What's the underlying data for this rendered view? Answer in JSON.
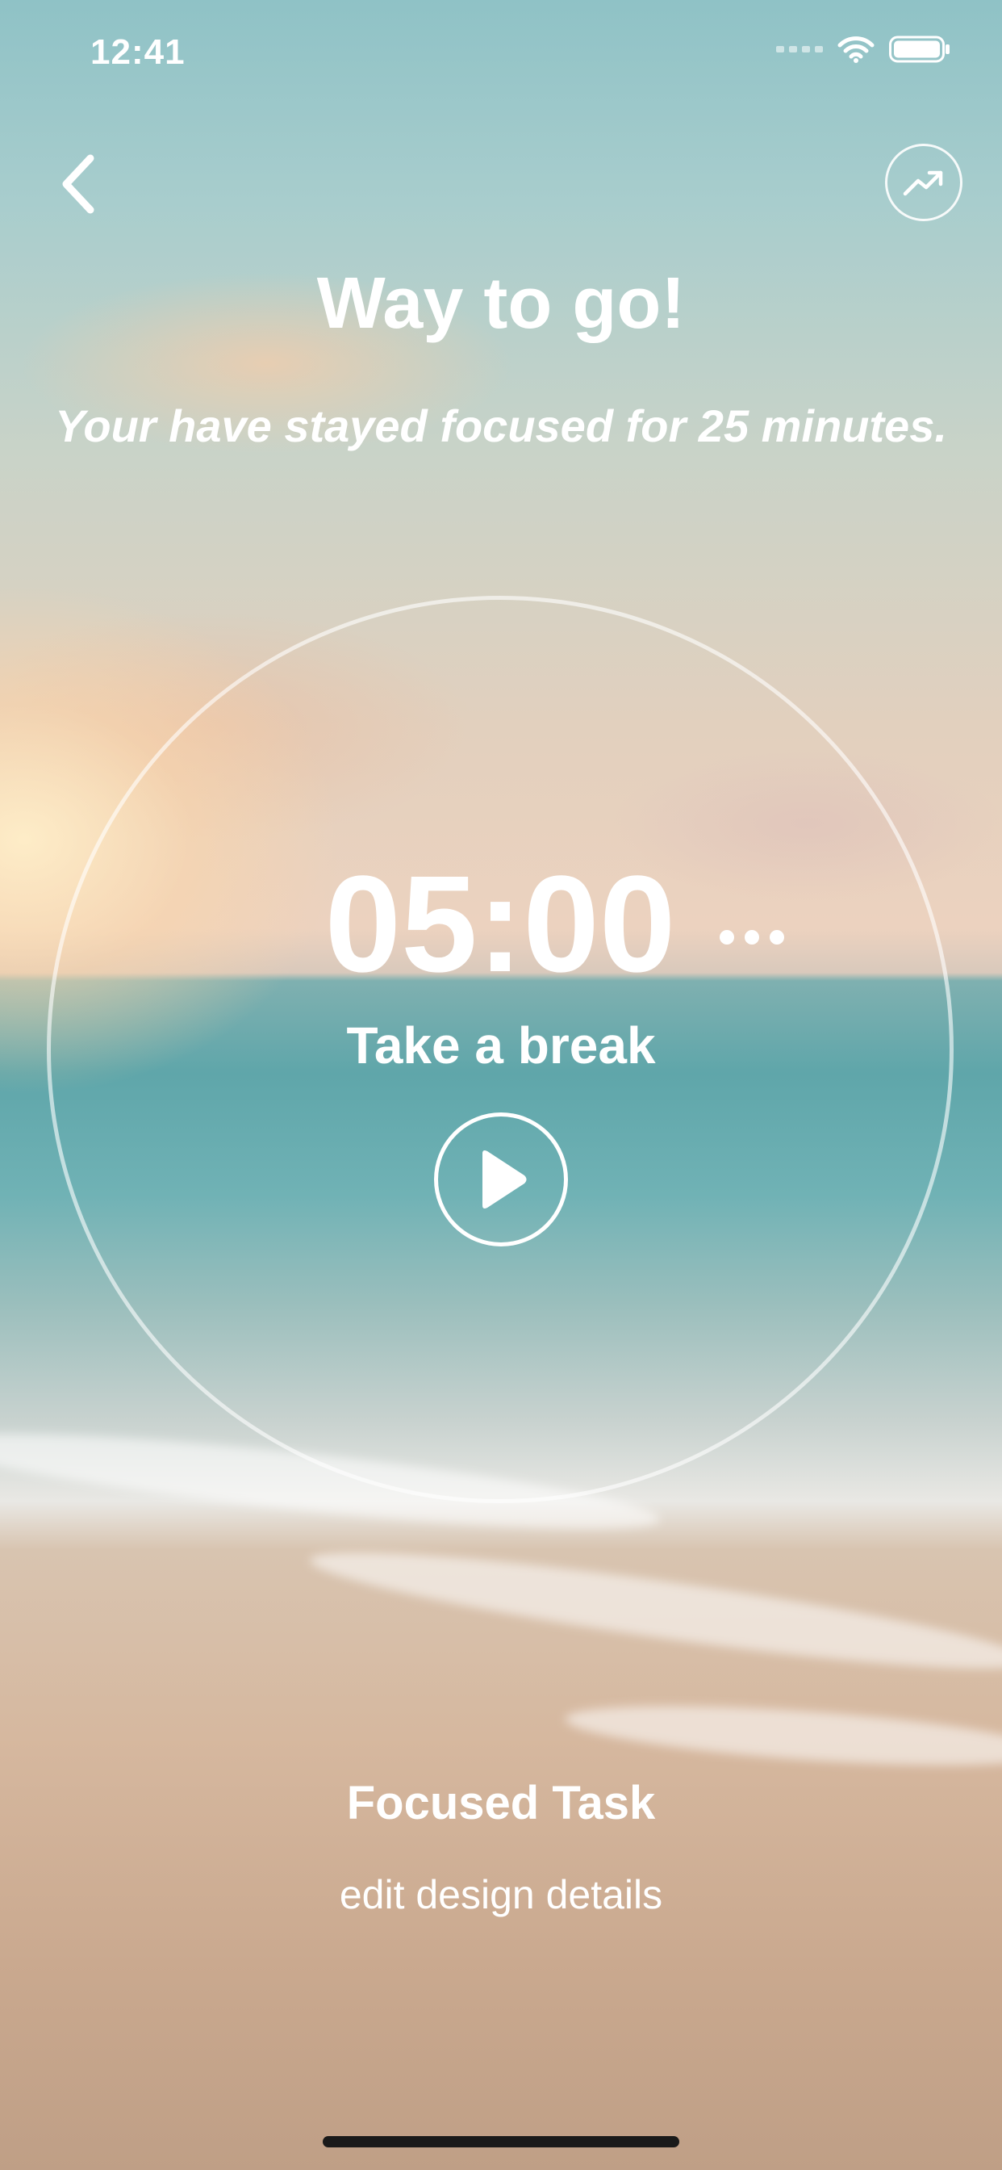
{
  "status_bar": {
    "time": "12:41"
  },
  "nav": {
    "back_icon": "chevron-left-icon",
    "stats_icon": "trending-up-icon"
  },
  "header": {
    "title": "Way to go!",
    "subtitle": "Your have stayed focused for 25 minutes."
  },
  "timer": {
    "value": "05:00",
    "label": "Take a break",
    "more_icon": "more-horizontal-icon",
    "play_icon": "play-icon"
  },
  "task": {
    "title": "Focused Task",
    "detail": "edit design details"
  },
  "colors": {
    "text": "#ffffff",
    "sky_top": "#8fc2c6",
    "sea": "#5fa6aa",
    "sand": "#d6b89f"
  }
}
